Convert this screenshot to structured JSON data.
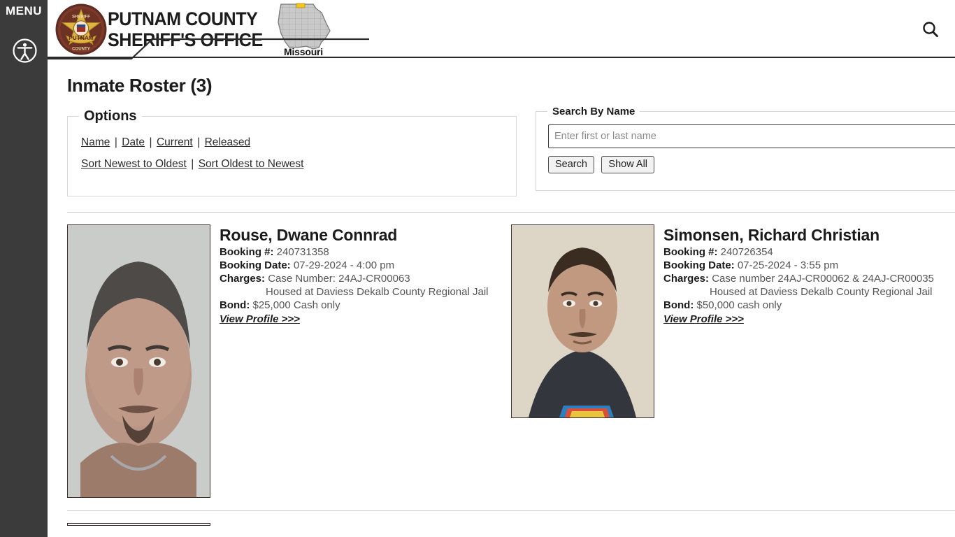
{
  "sidebar": {
    "menu_label": "MENU",
    "hamburger_icon": "hamburger-menu-icon",
    "accessibility_icon": "accessibility-icon"
  },
  "header": {
    "badge_icon": "sheriff-badge-icon",
    "badge_text_top": "SHERIFF",
    "badge_text_mid": "PUTNAM",
    "badge_text_bottom": "COUNTY",
    "org_line1": "PUTNAM COUNTY",
    "org_line2": "SHERIFF'S OFFICE",
    "state_label": "Missouri",
    "state_map_icon": "missouri-state-map-icon",
    "search_icon": "search-icon",
    "highlight_color": "#f5c518"
  },
  "main": {
    "page_title": "Inmate Roster (3)",
    "options": {
      "legend": "Options",
      "filters": [
        {
          "label": "Name"
        },
        {
          "label": "Date"
        },
        {
          "label": "Current"
        },
        {
          "label": "Released"
        }
      ],
      "sorts": [
        {
          "label": "Sort Newest to Oldest"
        },
        {
          "label": "Sort Oldest to Newest"
        }
      ],
      "separator": "|"
    },
    "search": {
      "legend": "Search By Name",
      "placeholder": "Enter first or last name",
      "value": "",
      "search_button": "Search",
      "show_all_button": "Show All"
    },
    "labels": {
      "booking_number": "Booking #:",
      "booking_date": "Booking Date:",
      "charges": "Charges:",
      "bond": "Bond:",
      "view_profile": "View Profile >>>"
    },
    "inmates": [
      {
        "name": "Rouse, Dwane Connrad",
        "booking_number": "240731358",
        "booking_date": "07-29-2024 - 4:00 pm",
        "charges_line1": "Case Number: 24AJ-CR00063",
        "charges_line2": "Housed at Daviess Dekalb County Regional Jail",
        "bond": "$25,000 Cash only",
        "view_profile": "View Profile >>>",
        "mugshot_alt": "mugshot-rouse-dwane-connrad"
      },
      {
        "name": "Simonsen, Richard Christian",
        "booking_number": "240726354",
        "booking_date": "07-25-2024 - 3:55 pm",
        "charges_line1": "Case number 24AJ-CR00062 & 24AJ-CR00035",
        "charges_line2": "Housed at Daviess Dekalb County Regional Jail",
        "bond": "$50,000 cash only",
        "view_profile": "View Profile >>>",
        "mugshot_alt": "mugshot-simonsen-richard-christian"
      }
    ]
  }
}
